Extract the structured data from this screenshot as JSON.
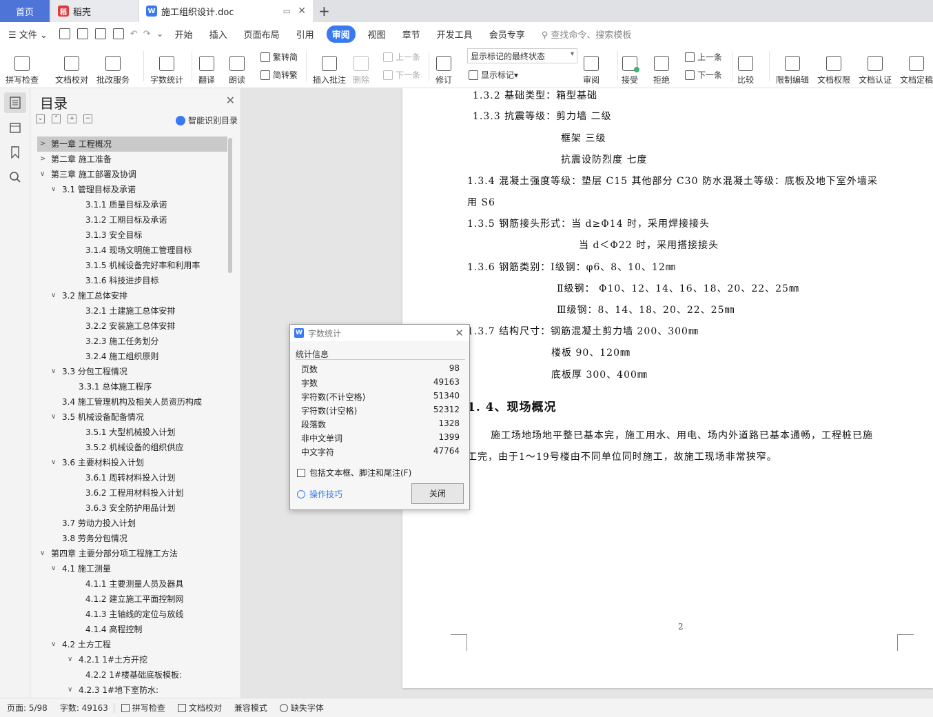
{
  "tabs": {
    "home": "首页",
    "docer": "稻壳",
    "document": "施工组织设计.doc"
  },
  "menu": {
    "file": "文件",
    "items": [
      "开始",
      "插入",
      "页面布局",
      "引用",
      "审阅",
      "视图",
      "章节",
      "开发工具",
      "会员专享"
    ],
    "active_index": 4,
    "search": "查找命令、搜索模板"
  },
  "ribbon": {
    "spell_check": "拼写检查",
    "doc_proof": "文档校对",
    "proof_service": "批改服务",
    "word_count": "字数统计",
    "translate": "翻译",
    "read_aloud": "朗读",
    "trad_to_simp": "繁转简",
    "simp_to_trad": "简转繁",
    "insert_comment": "插入批注",
    "delete": "删除",
    "prev_comment": "上一条",
    "next_comment": "下一条",
    "track_changes": "修订",
    "markup_state": "显示标记的最终状态",
    "show_markup": "显示标记",
    "review": "审阅",
    "accept": "接受",
    "reject": "拒绝",
    "prev_change": "上一条",
    "next_change": "下一条",
    "compare": "比较",
    "restrict_edit": "限制编辑",
    "doc_rights": "文档权限",
    "doc_cert": "文档认证",
    "doc_final": "文档定稿"
  },
  "toc": {
    "title": "目录",
    "smart": "智能识别目录",
    "items": [
      {
        "text": "第一章  工程概况",
        "level": 0,
        "arrow": "›",
        "selected": true
      },
      {
        "text": "第二章  施工准备",
        "level": 0,
        "arrow": "›"
      },
      {
        "text": "第三章    施工部署及协调",
        "level": 0,
        "arrow": "⌄"
      },
      {
        "text": "3.1 管理目标及承诺",
        "level": 1,
        "arrow": "⌄"
      },
      {
        "text": "3.1.1 质量目标及承诺",
        "level": 3
      },
      {
        "text": "3.1.2 工期目标及承诺",
        "level": 3
      },
      {
        "text": "3.1.3 安全目标",
        "level": 3
      },
      {
        "text": "3.1.4 现场文明施工管理目标",
        "level": 3
      },
      {
        "text": "3.1.5 机械设备完好率和利用率",
        "level": 3
      },
      {
        "text": "3.1.6 科技进步目标",
        "level": 3
      },
      {
        "text": "3.2 施工总体安排",
        "level": 1,
        "arrow": "⌄"
      },
      {
        "text": "3.2.1 土建施工总体安排",
        "level": 3
      },
      {
        "text": "3.2.2 安装施工总体安排",
        "level": 3
      },
      {
        "text": "3.2.3 施工任务划分",
        "level": 3
      },
      {
        "text": "3.2.4 施工组织原则",
        "level": 3
      },
      {
        "text": "3.3 分包工程情况",
        "level": 1,
        "arrow": "⌄"
      },
      {
        "text": "3.3.1 总体施工程序",
        "level": 2
      },
      {
        "text": "3.4 施工管理机构及相关人员资历构成",
        "level": 1
      },
      {
        "text": "3.5 机械设备配备情况",
        "level": 1,
        "arrow": "⌄"
      },
      {
        "text": "3.5.1 大型机械投入计划",
        "level": 3
      },
      {
        "text": "3.5.2 机械设备的组织供应",
        "level": 3
      },
      {
        "text": "3.6 主要材料投入计划",
        "level": 1,
        "arrow": "⌄"
      },
      {
        "text": "3.6.1 周转材料投入计划",
        "level": 3
      },
      {
        "text": "3.6.2 工程用材料投入计划",
        "level": 3
      },
      {
        "text": "3.6.3 安全防护用品计划",
        "level": 3
      },
      {
        "text": "3.7 劳动力投入计划",
        "level": 1
      },
      {
        "text": "3.8 劳务分包情况",
        "level": 1
      },
      {
        "text": "第四章  主要分部分项工程施工方法",
        "level": 0,
        "arrow": "⌄"
      },
      {
        "text": "4.1 施工测量",
        "level": 1,
        "arrow": "⌄"
      },
      {
        "text": "4.1.1 主要测量人员及器具",
        "level": 3
      },
      {
        "text": "4.1.2 建立施工平面控制网",
        "level": 3
      },
      {
        "text": "4.1.3 主轴线的定位与放线",
        "level": 3
      },
      {
        "text": "4.1.4 高程控制",
        "level": 3
      },
      {
        "text": "4.2 土方工程",
        "level": 1,
        "arrow": "⌄"
      },
      {
        "text": "4.2.1 1#土方开挖",
        "level": 2,
        "arrow": "⌄"
      },
      {
        "text": "4.2.2 1#楼基础底板模板:",
        "level": 3
      },
      {
        "text": "4.2.3 1#地下室防水:",
        "level": 2,
        "arrow": "⌄"
      }
    ]
  },
  "document": {
    "lines": [
      "1.3.2  基础类型：箱型基础",
      "1.3.3  抗震等级：剪力墙  二级",
      "框架   三级",
      "抗震设防烈度   七度",
      "1.3.4 混凝土强度等级：垫层 C15   其他部分 C30   防水混凝土等级：底板及地下室外墙采",
      "用 S6",
      "1.3.5  钢筋接头形式：当 d≥Φ14 时，采用焊接接头",
      "当 d＜Φ22 时，采用搭接接头",
      "1.3.6  钢筋类别：Ⅰ级钢：φ6、8、10、12㎜",
      "Ⅱ级钢： Φ10、12、14、16、18、20、22、25㎜",
      "Ⅲ级钢：8、14、18、20、22、25㎜",
      "1.3.7  结构尺寸：钢筋混凝土剪力墙  200、300㎜",
      "楼板   90、120㎜",
      "底板厚   300、400㎜",
      "1. 4、现场概况",
      "施工场地场地平整已基本完，施工用水、用电、场内外道路已基本通畅，工程桩已施",
      "工完，由于1～19号楼由不同单位同时施工，故施工现场非常狭窄。"
    ],
    "page_number": "2"
  },
  "dialog": {
    "title": "字数统计",
    "section": "统计信息",
    "stats": [
      {
        "label": "页数",
        "value": "98"
      },
      {
        "label": "字数",
        "value": "49163"
      },
      {
        "label": "字符数(不计空格)",
        "value": "51340"
      },
      {
        "label": "字符数(计空格)",
        "value": "52312"
      },
      {
        "label": "段落数",
        "value": "1328"
      },
      {
        "label": "非中文单词",
        "value": "1399"
      },
      {
        "label": "中文字符",
        "value": "47764"
      }
    ],
    "checkbox": "包括文本框、脚注和尾注(F)",
    "tips": "操作技巧",
    "close": "关闭"
  },
  "status": {
    "page": "页面: 5/98",
    "words": "字数: 49163",
    "spell": "拼写检查",
    "proof": "文档校对",
    "compat": "兼容模式",
    "missing_font": "缺失字体"
  },
  "colors": {
    "accent": "#3a7af0",
    "home_tab": "#4e74d8"
  }
}
